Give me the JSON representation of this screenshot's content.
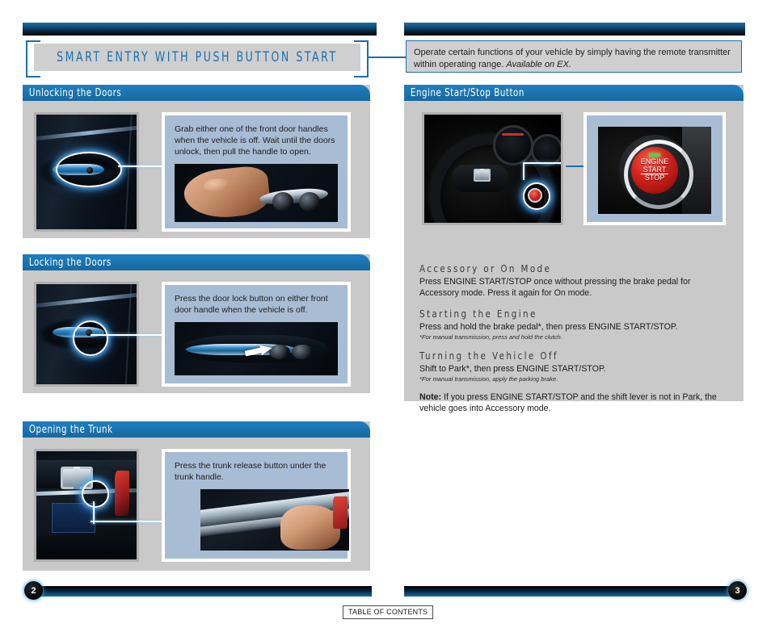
{
  "title": {
    "text": "SMART ENTRY WITH PUSH BUTTON START"
  },
  "callout": {
    "line1": "Operate certain functions of your vehicle by simply having the remote transmitter",
    "line2_prefix": "within operating range.",
    "line2_italic": "Available on EX."
  },
  "sections": {
    "unlocking": {
      "header": "Unlocking the Doors",
      "instruction": "Grab either one of the front door handles when the vehicle is off. Wait until the doors unlock, then pull the handle to open."
    },
    "locking": {
      "header": "Locking the Doors",
      "instruction": "Press the door lock button on either front door handle when the vehicle is off."
    },
    "trunk": {
      "header": "Opening the Trunk",
      "instruction": "Press the trunk release button under the trunk handle."
    },
    "engine": {
      "header": "Engine Start/Stop Button",
      "button_label_line1": "ENGINE",
      "button_label_line2": "START",
      "button_label_line3": "STOP",
      "blocks": [
        {
          "heading": "Accessory or On Mode",
          "body": "Press ENGINE START/STOP once without pressing the brake pedal for Accessory mode. Press it again for On mode."
        },
        {
          "heading": "Starting the Engine",
          "body": "Press and hold the brake pedal*,  then press ENGINE START/STOP.",
          "footnote": "*For manual transmission, press and hold the clutch."
        },
        {
          "heading": "Turning the Vehicle Off",
          "body": "Shift to Park*, then press ENGINE START/STOP.",
          "footnote": "*For manual transmission, apply the parking brake."
        }
      ],
      "note_label": "Note:",
      "note_text": " If you press ENGINE START/STOP and the shift lever is not in Park, the vehicle goes into Accessory mode."
    }
  },
  "footer": {
    "page_left": "2",
    "page_right": "3",
    "table_of_contents": "TABLE OF CONTENTS"
  },
  "colors": {
    "accent_blue": "#1a6fae",
    "header_blue": "#1b74b0",
    "panel_blue_grey": "#a8bcd4",
    "card_grey": "#c9c9c9",
    "plate_grey": "#cfcfcf"
  }
}
